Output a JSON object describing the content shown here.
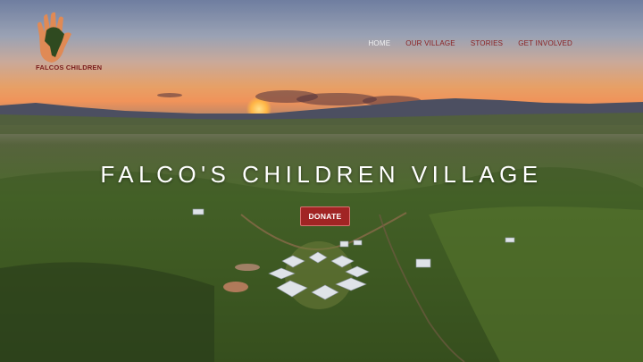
{
  "logo": {
    "text": "FALCOS CHILDREN"
  },
  "nav": {
    "items": [
      {
        "label": "HOME",
        "active": true
      },
      {
        "label": "OUR VILLAGE",
        "active": false
      },
      {
        "label": "STORIES",
        "active": false
      },
      {
        "label": "GET INVOLVED",
        "active": false
      }
    ]
  },
  "hero": {
    "title": "FALCO'S CHILDREN VILLAGE",
    "donate_label": "DONATE"
  },
  "colors": {
    "brand_red": "#a12424",
    "nav_text": "#8a2020",
    "nav_active": "#f3f3f3"
  }
}
